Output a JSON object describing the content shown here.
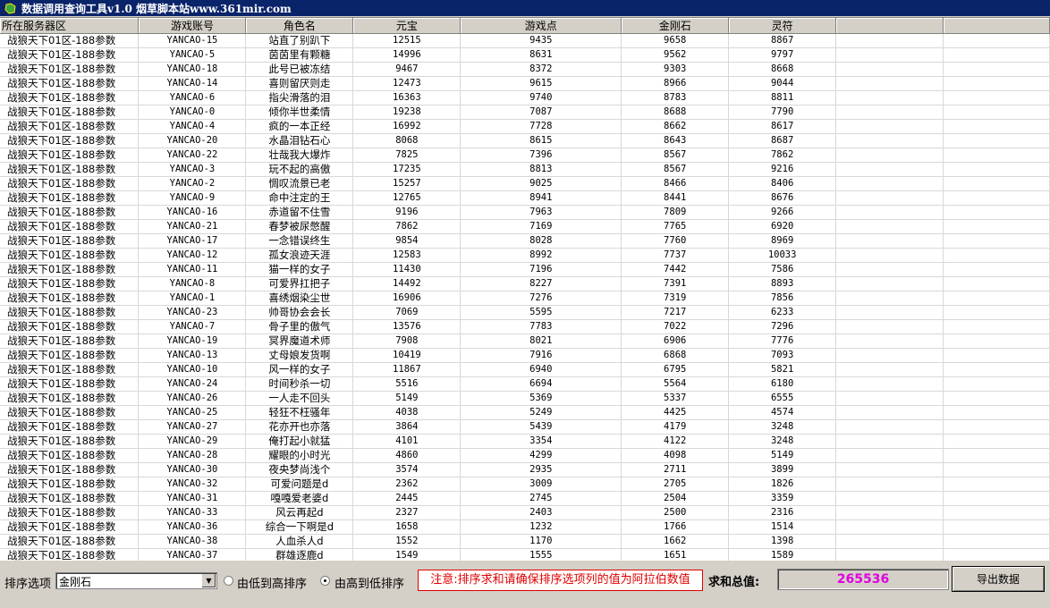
{
  "window": {
    "title": "数据调用查询工具v1.0  烟草脚本站www.361mir.com"
  },
  "table": {
    "columns": [
      "所在服务器区",
      "游戏账号",
      "角色名",
      "元宝",
      "游戏点",
      "金刚石",
      "灵符",
      "",
      ""
    ],
    "rows": [
      [
        "战狼天下01区-188参数",
        "YANCAO-15",
        "站直了别趴下",
        "12515",
        "9435",
        "9658",
        "8867"
      ],
      [
        "战狼天下01区-188参数",
        "YANCAO-5",
        "茵茵里有颗糖",
        "14996",
        "8631",
        "9562",
        "9797"
      ],
      [
        "战狼天下01区-188参数",
        "YANCAO-18",
        "此号已被冻结",
        "9467",
        "8372",
        "9303",
        "8668"
      ],
      [
        "战狼天下01区-188参数",
        "YANCAO-14",
        "喜则留厌则走",
        "12473",
        "9615",
        "8966",
        "9044"
      ],
      [
        "战狼天下01区-188参数",
        "YANCAO-6",
        "指尖滑落的泪",
        "16363",
        "9740",
        "8783",
        "8811"
      ],
      [
        "战狼天下01区-188参数",
        "YANCAO-0",
        "倾你半世柔情",
        "19238",
        "7087",
        "8688",
        "7790"
      ],
      [
        "战狼天下01区-188参数",
        "YANCAO-4",
        "疯的一本正经",
        "16992",
        "7728",
        "8662",
        "8617"
      ],
      [
        "战狼天下01区-188参数",
        "YANCAO-20",
        "水晶泪钻石心",
        "8068",
        "8615",
        "8643",
        "8687"
      ],
      [
        "战狼天下01区-188参数",
        "YANCAO-22",
        "壮哉我大爆炸",
        "7825",
        "7396",
        "8567",
        "7862"
      ],
      [
        "战狼天下01区-188参数",
        "YANCAO-3",
        "玩不起的高傲",
        "17235",
        "8813",
        "8567",
        "9216"
      ],
      [
        "战狼天下01区-188参数",
        "YANCAO-2",
        "惆叹流景已老",
        "15257",
        "9025",
        "8466",
        "8406"
      ],
      [
        "战狼天下01区-188参数",
        "YANCAO-9",
        "命中注定的王",
        "12765",
        "8941",
        "8441",
        "8676"
      ],
      [
        "战狼天下01区-188参数",
        "YANCAO-16",
        "赤道留不住雪",
        "9196",
        "7963",
        "7809",
        "9266"
      ],
      [
        "战狼天下01区-188参数",
        "YANCAO-21",
        "春梦被尿憋醒",
        "7862",
        "7169",
        "7765",
        "6920"
      ],
      [
        "战狼天下01区-188参数",
        "YANCAO-17",
        "一念错误终生",
        "9854",
        "8028",
        "7760",
        "8969"
      ],
      [
        "战狼天下01区-188参数",
        "YANCAO-12",
        "孤女浪迹天涯",
        "12583",
        "8992",
        "7737",
        "10033"
      ],
      [
        "战狼天下01区-188参数",
        "YANCAO-11",
        "猫一样的女子",
        "11430",
        "7196",
        "7442",
        "7586"
      ],
      [
        "战狼天下01区-188参数",
        "YANCAO-8",
        "可爱界扛把子",
        "14492",
        "8227",
        "7391",
        "8893"
      ],
      [
        "战狼天下01区-188参数",
        "YANCAO-1",
        "喜绣烟染尘世",
        "16906",
        "7276",
        "7319",
        "7856"
      ],
      [
        "战狼天下01区-188参数",
        "YANCAO-23",
        "帅哥协会会长",
        "7069",
        "5595",
        "7217",
        "6233"
      ],
      [
        "战狼天下01区-188参数",
        "YANCAO-7",
        "骨子里的傲气",
        "13576",
        "7783",
        "7022",
        "7296"
      ],
      [
        "战狼天下01区-188参数",
        "YANCAO-19",
        "冥界魔道术师",
        "7908",
        "8021",
        "6906",
        "7776"
      ],
      [
        "战狼天下01区-188参数",
        "YANCAO-13",
        "丈母娘发货啊",
        "10419",
        "7916",
        "6868",
        "7093"
      ],
      [
        "战狼天下01区-188参数",
        "YANCAO-10",
        "风一样的女子",
        "11867",
        "6940",
        "6795",
        "5821"
      ],
      [
        "战狼天下01区-188参数",
        "YANCAO-24",
        "时间秒杀一切",
        "5516",
        "6694",
        "5564",
        "6180"
      ],
      [
        "战狼天下01区-188参数",
        "YANCAO-26",
        "一人走不回头",
        "5149",
        "5369",
        "5337",
        "6555"
      ],
      [
        "战狼天下01区-188参数",
        "YANCAO-25",
        "轻狂不枉骚年",
        "4038",
        "5249",
        "4425",
        "4574"
      ],
      [
        "战狼天下01区-188参数",
        "YANCAO-27",
        "花亦开也亦落",
        "3864",
        "5439",
        "4179",
        "3248"
      ],
      [
        "战狼天下01区-188参数",
        "YANCAO-29",
        "俺打起小就猛",
        "4101",
        "3354",
        "4122",
        "3248"
      ],
      [
        "战狼天下01区-188参数",
        "YANCAO-28",
        "耀眼的小时光",
        "4860",
        "4299",
        "4098",
        "5149"
      ],
      [
        "战狼天下01区-188参数",
        "YANCAO-30",
        "夜央梦尚浅个",
        "3574",
        "2935",
        "2711",
        "3899"
      ],
      [
        "战狼天下01区-188参数",
        "YANCAO-32",
        "可爱问题是d",
        "2362",
        "3009",
        "2705",
        "1826"
      ],
      [
        "战狼天下01区-188参数",
        "YANCAO-31",
        "嘎嘎爱老婆d",
        "2445",
        "2745",
        "2504",
        "3359"
      ],
      [
        "战狼天下01区-188参数",
        "YANCAO-33",
        "风云再起d",
        "2327",
        "2403",
        "2500",
        "2316"
      ],
      [
        "战狼天下01区-188参数",
        "YANCAO-36",
        "综合一下啊是d",
        "1658",
        "1232",
        "1766",
        "1514"
      ],
      [
        "战狼天下01区-188参数",
        "YANCAO-38",
        "人血杀人d",
        "1552",
        "1170",
        "1662",
        "1398"
      ],
      [
        "战狼天下01区-188参数",
        "YANCAO-37",
        "群雄逐鹿d",
        "1549",
        "1555",
        "1651",
        "1589"
      ]
    ]
  },
  "bottom": {
    "sort_label": "排序选项",
    "sort_value": "金刚石",
    "radio_asc": "由低到高排序",
    "radio_desc": "由高到低排序",
    "notice": "注意:排序求和请确保排序选项列的值为阿拉伯数值",
    "total_label": "求和总值:",
    "total_value": "265536",
    "export_label": "导出数据"
  },
  "colors": {
    "title_bar": "#0a246a",
    "notice": "#e00000",
    "total": "#e000e0",
    "icon": "puzzle-icon"
  }
}
